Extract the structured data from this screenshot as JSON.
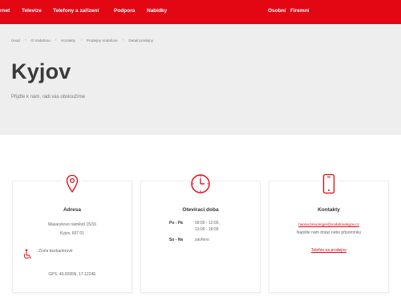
{
  "nav": {
    "items": [
      "rnet",
      "Televize",
      "Telefony a zařízení",
      "Podpora",
      "Nabídky"
    ],
    "right": [
      "Osobní",
      "Firemní"
    ]
  },
  "breadcrumb": [
    "Úvod",
    "O Vodafonu",
    "Kontakty",
    "Prodejny Vodafone",
    "Detail prodejny"
  ],
  "page": {
    "title": "Kyjov",
    "subtitle": "Přijďte k nám, rádi vás obsloužíme"
  },
  "cards": {
    "address": {
      "icon": "map-pin-icon",
      "heading": "Adresa",
      "street": "Masarykovo náměstí 15/16",
      "city": "Kyjov, 697 01",
      "access_icon": "wheelchair-icon",
      "access": "Zcela bezbariérové",
      "gps": "GPS: 49.0095N, 17.1224E"
    },
    "hours": {
      "icon": "clock-icon",
      "heading": "Otevírací doba",
      "rows": [
        {
          "day": "Po - Pá",
          "values": [
            "09:00 - 12:00,",
            "13:00 - 18:00"
          ]
        },
        {
          "day": "So - Ne",
          "values": [
            "zavřeno"
          ]
        }
      ]
    },
    "contacts": {
      "icon": "phone-icon",
      "heading": "Kontakty",
      "email": "hanna.breuninger@vodafonekyjov.cz",
      "note": "Napište nám dotaz nebo připomínku",
      "link": "Telefon na prodejnu"
    }
  },
  "colors": {
    "brand": "#e30613",
    "hero_bg": "#eeeeee"
  }
}
